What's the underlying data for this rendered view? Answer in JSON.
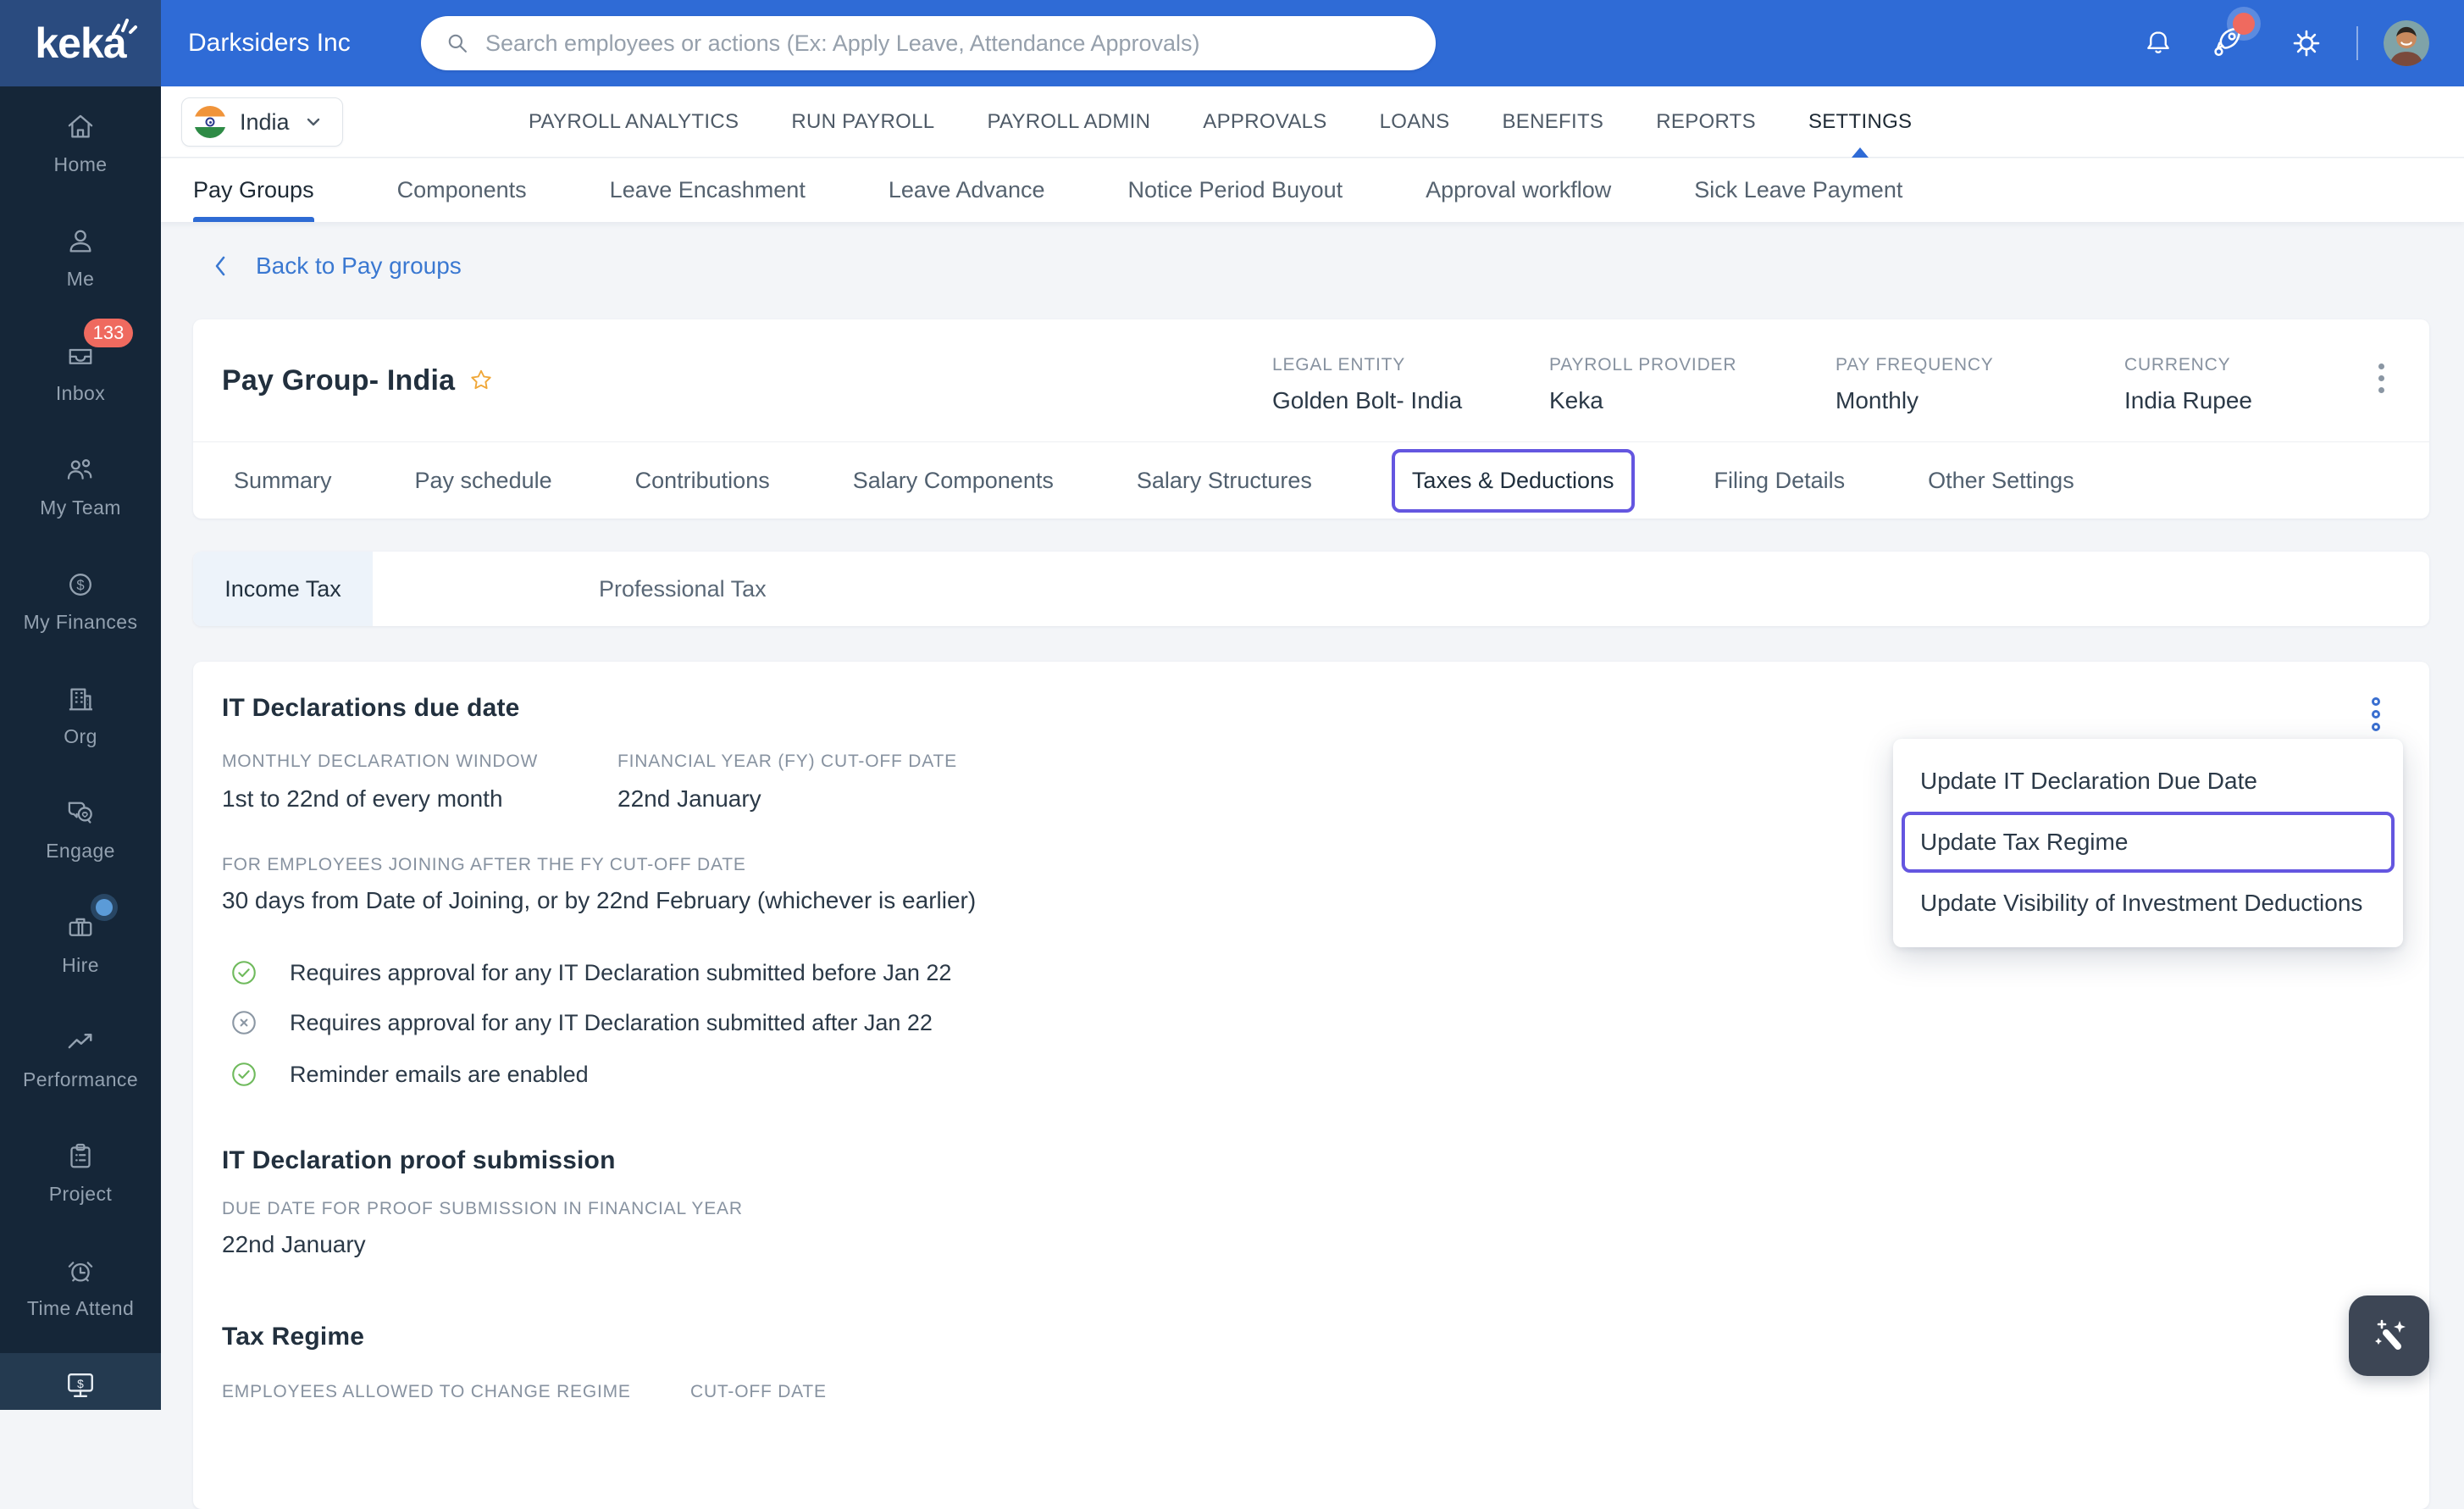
{
  "colors": {
    "header_blue": "#2f6bd6",
    "logo_tile_blue": "#2a4b7f",
    "sidebar_navy": "#152638",
    "accent_purple": "#6456e0",
    "link_blue": "#3a78d1",
    "active_underline_blue": "#2e6bd4",
    "badge_red": "#ef6a5f",
    "check_green": "#6fba5c",
    "page_bg": "#f3f5f8"
  },
  "header": {
    "logo": "keka",
    "company": "Darksiders Inc",
    "search_placeholder": "Search employees or actions (Ex: Apply Leave, Attendance Approvals)"
  },
  "sidebar": {
    "items": [
      {
        "label": "Home"
      },
      {
        "label": "Me"
      },
      {
        "label": "Inbox",
        "badge": "133"
      },
      {
        "label": "My Team"
      },
      {
        "label": "My Finances"
      },
      {
        "label": "Org"
      },
      {
        "label": "Engage"
      },
      {
        "label": "Hire"
      },
      {
        "label": "Performance"
      },
      {
        "label": "Project"
      },
      {
        "label": "Time Attend"
      }
    ]
  },
  "topnav": {
    "country": "India",
    "items": [
      "PAYROLL ANALYTICS",
      "RUN PAYROLL",
      "PAYROLL ADMIN",
      "APPROVALS",
      "LOANS",
      "BENEFITS",
      "REPORTS",
      "SETTINGS"
    ],
    "active": "SETTINGS"
  },
  "subnav": {
    "items": [
      "Pay Groups",
      "Components",
      "Leave Encashment",
      "Leave Advance",
      "Notice Period Buyout",
      "Approval workflow",
      "Sick Leave Payment"
    ],
    "active": "Pay Groups"
  },
  "back_link": "Back to Pay groups",
  "paygroup": {
    "title": "Pay Group- India",
    "info": [
      {
        "label": "LEGAL ENTITY",
        "value": "Golden Bolt- India"
      },
      {
        "label": "PAYROLL PROVIDER",
        "value": "Keka"
      },
      {
        "label": "PAY FREQUENCY",
        "value": "Monthly"
      },
      {
        "label": "CURRENCY",
        "value": "India Rupee"
      }
    ],
    "tabs": [
      "Summary",
      "Pay schedule",
      "Contributions",
      "Salary Components",
      "Salary Structures",
      "Taxes & Deductions",
      "Filing Details",
      "Other Settings"
    ],
    "active_tab": "Taxes & Deductions"
  },
  "tax_tabs": {
    "items": [
      "Income Tax",
      "Professional Tax"
    ],
    "active": "Income Tax"
  },
  "it_declarations": {
    "title": "IT Declarations due date",
    "fields": [
      {
        "label": "MONTHLY DECLARATION WINDOW",
        "value": "1st to 22nd of every month"
      },
      {
        "label": "FINANCIAL YEAR (FY) CUT-OFF DATE",
        "value": "22nd January"
      }
    ],
    "joining_label": "FOR EMPLOYEES JOINING AFTER THE FY CUT-OFF DATE",
    "joining_value": "30 days from Date of Joining, or by 22nd February (whichever is earlier)",
    "checks": [
      {
        "text": "Requires approval for any IT Declaration submitted before Jan 22",
        "state": "check"
      },
      {
        "text": "Requires approval for any IT Declaration submitted after Jan 22",
        "state": "cross"
      },
      {
        "text": "Reminder emails are enabled",
        "state": "check"
      }
    ]
  },
  "proof_submission": {
    "title": "IT Declaration proof submission",
    "label": "DUE DATE FOR PROOF SUBMISSION IN FINANCIAL YEAR",
    "value": "22nd January"
  },
  "tax_regime": {
    "title": "Tax Regime",
    "labels": [
      "EMPLOYEES ALLOWED TO CHANGE REGIME",
      "CUT-OFF DATE"
    ]
  },
  "context_menu": {
    "items": [
      "Update IT Declaration Due Date",
      "Update Tax Regime",
      "Update Visibility of Investment Deductions"
    ],
    "highlighted": "Update Tax Regime"
  }
}
